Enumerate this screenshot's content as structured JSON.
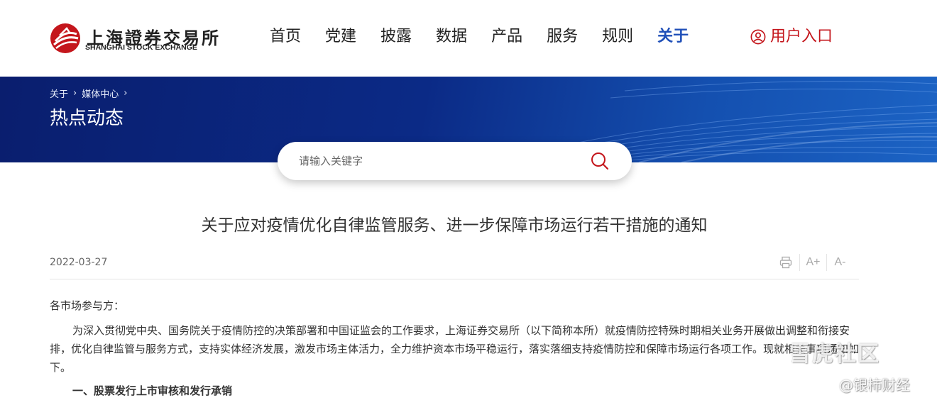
{
  "header": {
    "logo": {
      "name_cn": "上海證券交易所",
      "name_en": "SHANGHAI STOCK EXCHANGE"
    },
    "nav": [
      "首页",
      "党建",
      "披露",
      "数据",
      "产品",
      "服务",
      "规则",
      "关于"
    ],
    "nav_active": "关于",
    "user_entry": "用户入口"
  },
  "banner": {
    "breadcrumb": [
      "关于",
      "媒体中心"
    ],
    "title": "热点动态"
  },
  "search": {
    "placeholder": "请输入关键字"
  },
  "article": {
    "title": "关于应对疫情优化自律监管服务、进一步保障市场运行若干措施的通知",
    "date": "2022-03-27",
    "tools": {
      "print_icon": "printer-icon",
      "font_increase": "A+",
      "font_decrease": "A-"
    },
    "salutation": "各市场参与方：",
    "paragraph": "为深入贯彻党中央、国务院关于疫情防控的决策部署和中国证监会的工作要求，上海证券交易所（以下简称本所）就疫情防控特殊时期相关业务开展做出调整和衔接安排，优化自律监管与服务方式，支持实体经济发展，激发市场主体活力，全力维护资本市场平稳运行，落实落细支持疫情防控和保障市场运行各项工作。现就相关事项通知如下。",
    "section_heading": "一、股票发行上市审核和发行承销"
  },
  "watermark": {
    "line1": "雪虎社区",
    "line2": "@银柿财经"
  },
  "colors": {
    "brand_red": "#c4161c",
    "nav_active": "#1f4fb8",
    "banner_dark": "#0a1e6e"
  }
}
